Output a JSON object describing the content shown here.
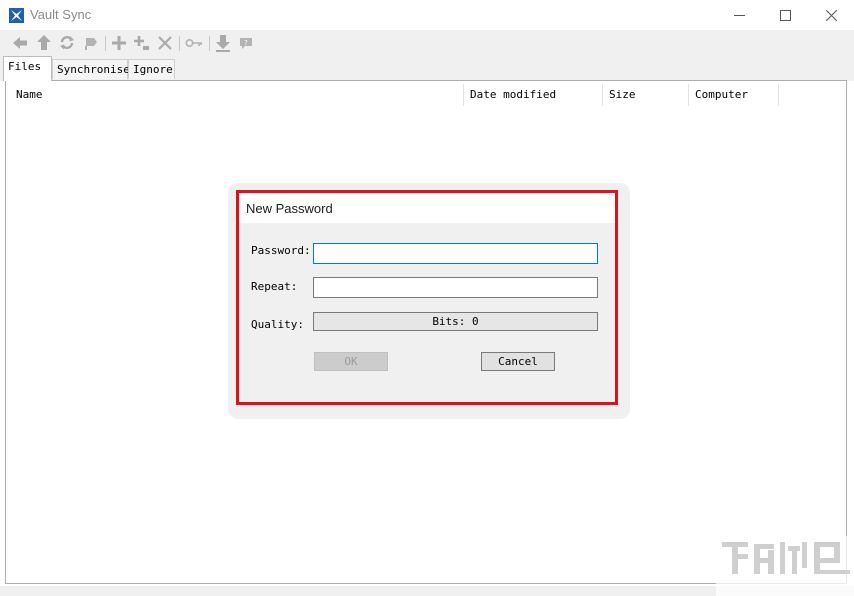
{
  "window": {
    "title": "Vault Sync"
  },
  "tabs": [
    {
      "label": "Files",
      "active": true
    },
    {
      "label": "Synchronise",
      "active": false
    },
    {
      "label": "Ignore",
      "active": false
    }
  ],
  "grid": {
    "columns": [
      "Name",
      "Date modified",
      "Size",
      "Computer"
    ]
  },
  "dialog": {
    "title": "New Password",
    "password_label": "Password:",
    "password_value": "",
    "repeat_label": "Repeat:",
    "repeat_value": "",
    "quality_label": "Quality:",
    "quality_value": "Bits: 0",
    "ok_label": "OK",
    "cancel_label": "Cancel"
  },
  "colors": {
    "highlight_border": "#e0101e",
    "focus_border": "#0078d7",
    "app_icon": "#1f5fae"
  },
  "icons": [
    "back-arrow-icon",
    "up-arrow-icon",
    "refresh-icon",
    "tag-icon",
    "add-icon",
    "add-sub-icon",
    "delete-icon",
    "key-icon",
    "download-icon",
    "help-icon"
  ]
}
